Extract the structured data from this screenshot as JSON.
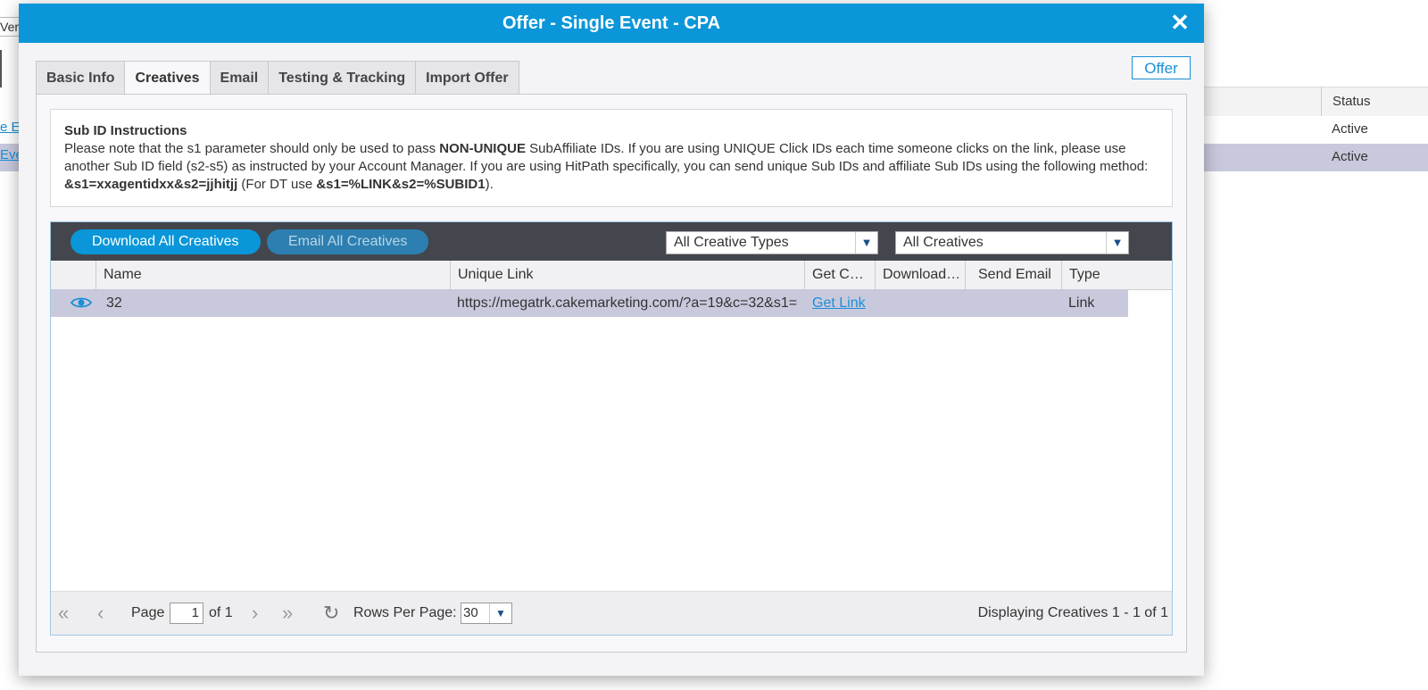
{
  "background": {
    "left_text": "Ver",
    "left_links": [
      "e Ev",
      "Eve"
    ],
    "status_header": "Status",
    "statuses": [
      "Active",
      "Active"
    ]
  },
  "modal": {
    "title": "Offer - Single Event - CPA",
    "close_symbol": "✕",
    "offer_button": "Offer",
    "tabs": [
      {
        "label": "Basic Info"
      },
      {
        "label": "Creatives"
      },
      {
        "label": "Email"
      },
      {
        "label": "Testing & Tracking"
      },
      {
        "label": "Import Offer"
      }
    ],
    "instructions": {
      "title": "Sub ID Instructions",
      "part1": "Please note that the s1 parameter should only be used to pass ",
      "bold1": "NON-UNIQUE",
      "part2": " SubAffiliate IDs. If you are using UNIQUE Click IDs each time someone clicks on the link, please use another Sub ID field (s2-s5) as instructed by your Account Manager. If you are using HitPath specifically, you can send unique Sub IDs and affiliate Sub IDs using the following method: ",
      "bold2": "&s1=xxagentidxx&s2=jjhitjj",
      "part3": " (For DT use ",
      "bold3": "&s1=%LINK&s2=%SUBID1",
      "part4": ")."
    },
    "toolbar": {
      "download_all": "Download All Creatives",
      "email_all": "Email All Creatives",
      "creative_types": "All Creative Types",
      "creatives": "All Creatives"
    },
    "grid": {
      "columns": [
        "Name",
        "Unique Link",
        "Get C…",
        "Download…",
        "Send Email",
        "Type"
      ],
      "rows": [
        {
          "name": "32",
          "unique_link": "https://megatrk.cakemarketing.com/?a=19&c=32&s1=",
          "get_code": "Get Link",
          "download": "",
          "send_email": "",
          "type": "Link"
        }
      ]
    },
    "pager": {
      "page_label": "Page",
      "page_value": "1",
      "of_label": "of 1",
      "rows_per_page_label": "Rows Per Page:",
      "rows_per_page_value": "30",
      "display_text": "Displaying Creatives 1 - 1 of 1"
    }
  }
}
